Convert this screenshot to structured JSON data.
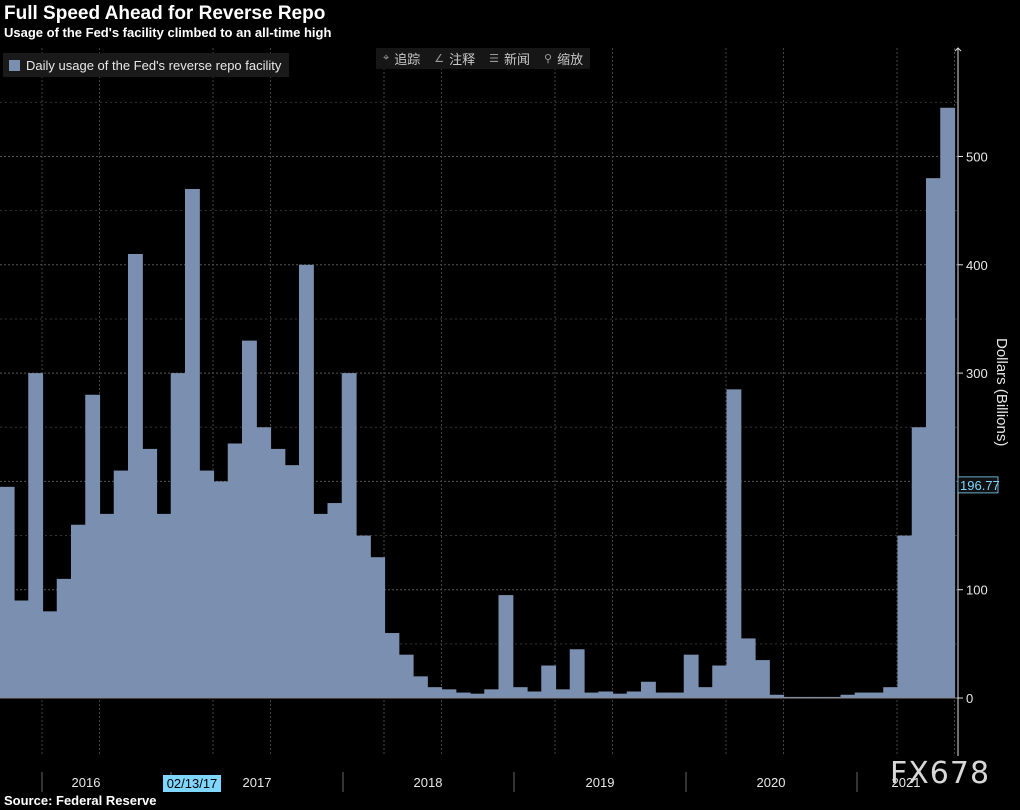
{
  "chart_data": {
    "type": "bar",
    "title": "Full Speed Ahead for Reverse Repo",
    "subtitle": "Usage of the Fed's facility climbed to an all-time high",
    "ylabel": "Dollars (Billions)",
    "ylim": [
      -50,
      600
    ],
    "y_ticks": [
      0,
      100,
      200,
      300,
      400,
      500
    ],
    "y_tick_labels": [
      "0",
      "100",
      "",
      "300",
      "400",
      "500"
    ],
    "x_ticks": [
      "2016",
      "2017",
      "2018",
      "2019",
      "2020",
      "2021"
    ],
    "legend": "Daily usage of the Fed's reverse repo facility",
    "legend_position": "top-left",
    "grid": true,
    "last_value_label": "196.77",
    "crosshair_date_label": "02/13/17",
    "series": [
      {
        "name": "Daily usage of the Fed's reverse repo facility",
        "color": "#7b90b0",
        "x": [
          "2015-12",
          "2016-01",
          "2016-02",
          "2016-03",
          "2016-04",
          "2016-05",
          "2016-06",
          "2016-07",
          "2016-08",
          "2016-09",
          "2016-10",
          "2016-11",
          "2016-12",
          "2017-01",
          "2017-02",
          "2017-03",
          "2017-04",
          "2017-05",
          "2017-06",
          "2017-07",
          "2017-08",
          "2017-09",
          "2017-10",
          "2017-11",
          "2017-12",
          "2018-01",
          "2018-02",
          "2018-03",
          "2018-04",
          "2018-05",
          "2018-06",
          "2018-07",
          "2018-08",
          "2018-09",
          "2018-10",
          "2018-11",
          "2018-12",
          "2019-01",
          "2019-02",
          "2019-03",
          "2019-04",
          "2019-05",
          "2019-06",
          "2019-07",
          "2019-08",
          "2019-09",
          "2019-10",
          "2019-11",
          "2019-12",
          "2020-01",
          "2020-02",
          "2020-03",
          "2020-04",
          "2020-05",
          "2020-06",
          "2020-07",
          "2020-08",
          "2020-09",
          "2020-10",
          "2020-11",
          "2020-12",
          "2021-01",
          "2021-02",
          "2021-03",
          "2021-04",
          "2021-05",
          "2021-06"
        ],
        "values": [
          195,
          90,
          300,
          80,
          110,
          160,
          280,
          170,
          210,
          410,
          230,
          170,
          300,
          470,
          210,
          200,
          235,
          330,
          250,
          230,
          215,
          400,
          170,
          180,
          300,
          150,
          130,
          60,
          40,
          20,
          10,
          8,
          5,
          4,
          8,
          95,
          10,
          6,
          30,
          8,
          45,
          5,
          6,
          4,
          6,
          15,
          5,
          5,
          40,
          10,
          30,
          285,
          55,
          35,
          3,
          1,
          1,
          1,
          1,
          3,
          5,
          5,
          10,
          150,
          250,
          480,
          545
        ]
      }
    ]
  },
  "toolbar": {
    "items": [
      {
        "label": "追踪",
        "icon": "crosshair-icon"
      },
      {
        "label": "注释",
        "icon": "pencil-icon"
      },
      {
        "label": "新闻",
        "icon": "news-icon"
      },
      {
        "label": "缩放",
        "icon": "zoom-icon"
      }
    ]
  },
  "footer": {
    "source": "Source: Federal Reserve"
  },
  "watermark": "FX678"
}
